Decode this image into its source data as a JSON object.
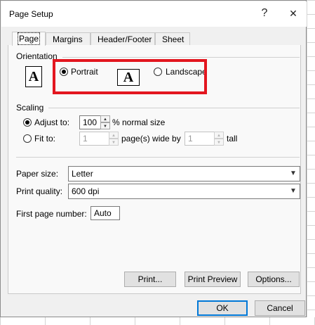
{
  "window": {
    "title": "Page Setup",
    "help_glyph": "?",
    "close_glyph": "✕"
  },
  "tabs": [
    {
      "label": "Page",
      "active": true
    },
    {
      "label": "Margins"
    },
    {
      "label": "Header/Footer"
    },
    {
      "label": "Sheet"
    }
  ],
  "orientation": {
    "label": "Orientation",
    "portrait_label": "Portrait",
    "landscape_label": "Landscape",
    "selected": "portrait",
    "icon_glyph": "A"
  },
  "scaling": {
    "label": "Scaling",
    "adjust_label": "Adjust to:",
    "adjust_value": "100",
    "adjust_suffix": "% normal size",
    "fit_label": "Fit to:",
    "fit_wide_value": "1",
    "fit_wide_suffix": "page(s) wide by",
    "fit_tall_value": "1",
    "fit_tall_suffix": "tall",
    "selected": "adjust"
  },
  "paper_size": {
    "label": "Paper size:",
    "value": "Letter"
  },
  "print_quality": {
    "label": "Print quality:",
    "value": "600 dpi"
  },
  "first_page_number": {
    "label": "First page number:",
    "value": "Auto"
  },
  "buttons": {
    "print": "Print...",
    "print_preview": "Print Preview",
    "options": "Options...",
    "ok": "OK",
    "cancel": "Cancel"
  },
  "colors": {
    "highlight_box": "#e3161f",
    "focus_border": "#0078d7"
  },
  "icons": [
    "help-icon",
    "close-icon",
    "portrait-page-icon",
    "landscape-page-icon",
    "spin-up-icon",
    "spin-down-icon",
    "dropdown-arrow-icon"
  ]
}
